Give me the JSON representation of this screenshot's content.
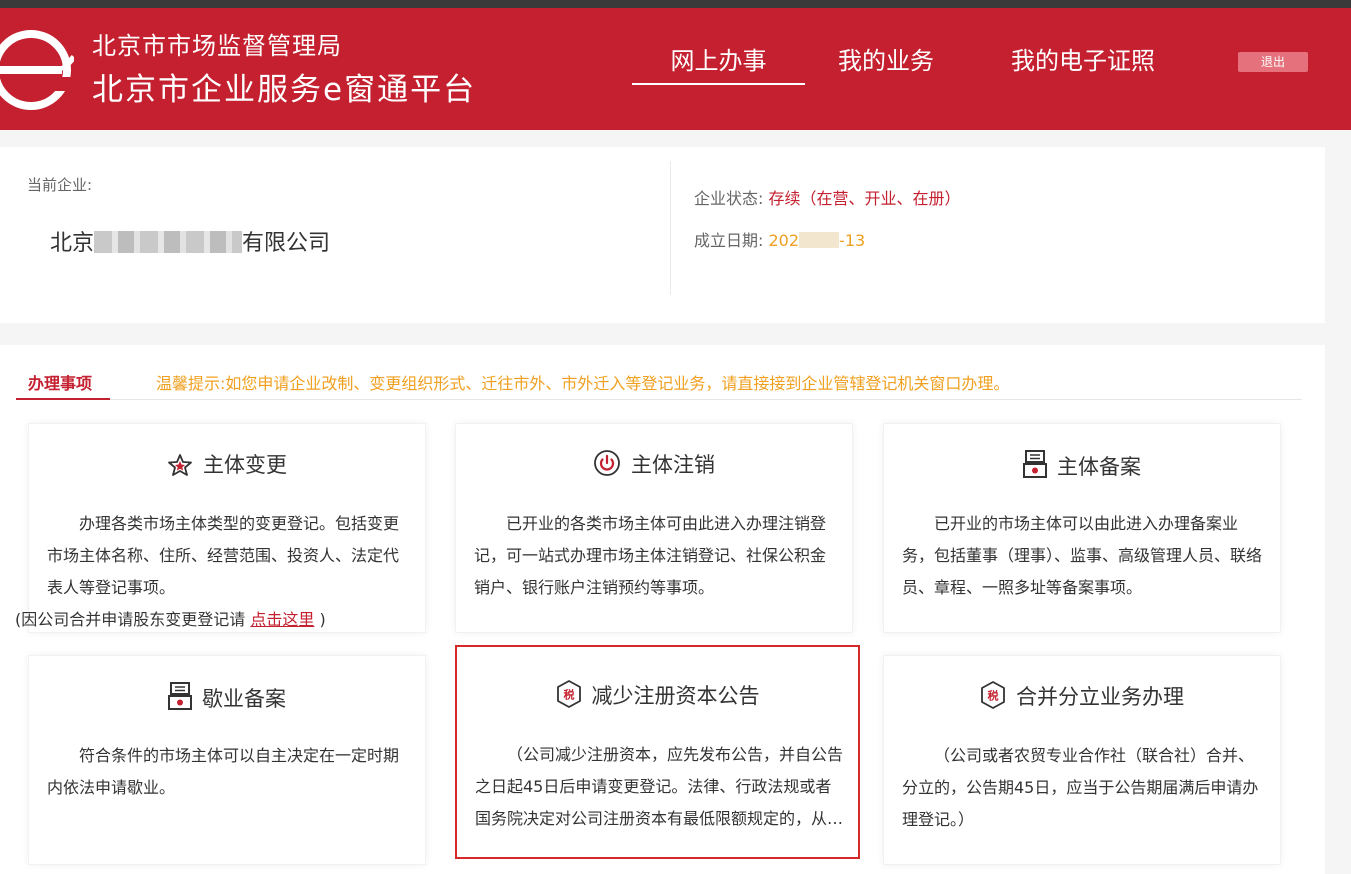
{
  "header": {
    "org_name": "北京市市场监督管理局",
    "platform_name": "北京市企业服务e窗通平台",
    "nav": [
      "网上办事",
      "我的业务",
      "我的电子证照"
    ],
    "logout": "退出",
    "logo_icon": "e-logo-icon"
  },
  "company": {
    "label": "当前企业:",
    "name_prefix": "北京",
    "name_suffix": "有限公司",
    "status_label": "企业状态:",
    "status_value": "存续（在营、开业、在册）",
    "date_label": "成立日期:",
    "date_prefix": "202",
    "date_suffix": "-13"
  },
  "tasks": {
    "tab": "办理事项",
    "tip": "温馨提示:如您申请企业改制、变更组织形式、迁往市外、市外迁入等登记业务，请直接接到企业管辖登记机关窗口办理。",
    "cards": [
      {
        "title": "主体变更",
        "icon": "star-badge-icon",
        "desc": "办理各类市场主体类型的变更登记。包括变更市场主体名称、住所、经营范围、投资人、法定代表人等登记事项。",
        "note_prefix": "(因公司合并申请股东变更登记请 ",
        "note_link": "点击这里",
        "note_suffix": " )"
      },
      {
        "title": "主体注销",
        "icon": "power-icon",
        "desc": "已开业的各类市场主体可由此进入办理注销登记，可一站式办理市场主体注销登记、社保公积金销户、银行账户注销预约等事项。"
      },
      {
        "title": "主体备案",
        "icon": "filing-icon",
        "desc": "已开业的市场主体可以由此进入办理备案业务，包括董事（理事）、监事、高级管理人员、联络员、章程、一照多址等备案事项。"
      },
      {
        "title": "歇业备案",
        "icon": "filing-icon",
        "desc": "符合条件的市场主体可以自主决定在一定时期内依法申请歇业。"
      },
      {
        "title": "减少注册资本公告",
        "icon": "tax-badge-icon",
        "badge_text": "税",
        "desc": "（公司减少注册资本，应先发布公告，并自公告之日起45日后申请变更登记。法律、行政法规或者国务院决定对公司注册资本有最低限额规定的，从其规定。）"
      },
      {
        "title": "合并分立业务办理",
        "icon": "tax-badge-icon",
        "badge_text": "税",
        "desc": "（公司或者农贸专业合作社（联合社）合并、分立的，公告期45日，应当于公告期届满后申请办理登记。）"
      }
    ]
  },
  "colors": {
    "brand_red": "#c4202f",
    "orange": "#f0a020",
    "selected_border": "#d42a2a"
  }
}
